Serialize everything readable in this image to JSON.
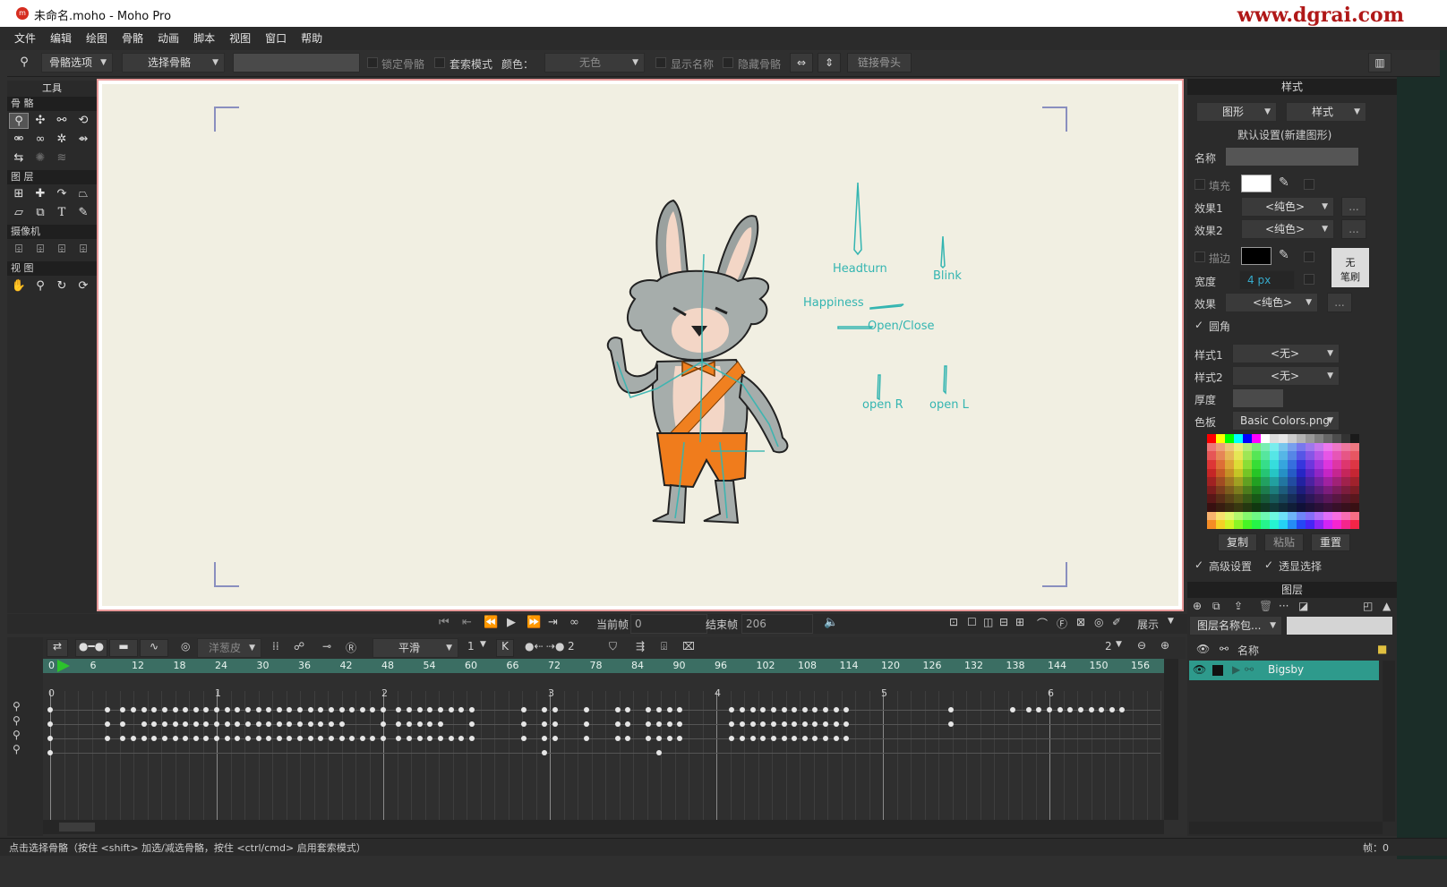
{
  "window": {
    "title": "未命名.moho - Moho Pro",
    "watermark": "www.dgrai.com"
  },
  "menu": [
    "文件",
    "编辑",
    "绘图",
    "骨骼",
    "动画",
    "脚本",
    "视图",
    "窗口",
    "帮助"
  ],
  "toolbar": {
    "bone_options": "骨骼选项",
    "select_bone": "选择骨骼",
    "lock_bone": "锁定骨骼",
    "lasso_mode": "套索模式",
    "color_label": "颜色：",
    "color_value": "无色",
    "show_names": "显示名称",
    "hide_bones": "隐藏骨骼",
    "link_bones": "链接骨头"
  },
  "tools": {
    "header": "工具",
    "sections": {
      "bone": "骨 骼",
      "layer": "图 层",
      "camera": "摄像机",
      "view": "视 图"
    }
  },
  "canvas": {
    "bone_labels": {
      "headturn": "Headturn",
      "blink": "Blink",
      "happiness": "Happiness",
      "open_close": "Open/Close",
      "open_r": "open R",
      "open_l": "open L"
    },
    "colors": {
      "background": "#f1efe2",
      "bone": "#34b5b1",
      "frame": "#e99a9a"
    }
  },
  "style_panel": {
    "title": "样式",
    "shape_dd": "图形",
    "style_dd": "样式",
    "defaults": "默认设置(新建图形)",
    "name_label": "名称",
    "fill_label": "填充",
    "effect1_label": "效果1",
    "effect1_value": "<纯色>",
    "effect2_label": "效果2",
    "effect2_value": "<纯色>",
    "stroke_label": "描边",
    "no_brush": "无\n笔刷",
    "width_label": "宽度",
    "width_value": "4 px",
    "effect_label": "效果",
    "effect_value": "<纯色>",
    "round_caps": "圆角",
    "style1_label": "样式1",
    "style1_value": "<无>",
    "style2_label": "样式2",
    "style2_value": "<无>",
    "thickness_label": "厚度",
    "palette_label": "色板",
    "palette_value": "Basic Colors.png",
    "copy": "复制",
    "paste": "粘贴",
    "reset": "重置",
    "advanced": "高级设置",
    "transparent_select": "透显选择",
    "ellipsis": "..."
  },
  "playback": {
    "current_frame_label": "当前帧",
    "current_frame": "0",
    "end_frame_label": "结束帧",
    "end_frame": "206",
    "display": "展示"
  },
  "timeline": {
    "onion_skin": "洋葱皮",
    "smooth": "平滑",
    "step": "1",
    "step2": "2",
    "zoom": "2",
    "ruler_ticks": [
      "0",
      "6",
      "12",
      "18",
      "24",
      "30",
      "36",
      "42",
      "48",
      "54",
      "60",
      "66",
      "72",
      "78",
      "84",
      "90",
      "96",
      "102",
      "108",
      "114",
      "120",
      "126",
      "132",
      "138",
      "144",
      "150",
      "156"
    ],
    "second_marks": [
      "0",
      "1",
      "2",
      "3",
      "4",
      "5",
      "6"
    ]
  },
  "layers": {
    "title": "图层",
    "filter_dd": "图层名称包...",
    "name_col": "名称",
    "layer_name": "Bigsby"
  },
  "status": {
    "hint": "点击选择骨骼（按住 <shift> 加选/减选骨骼，按住 <ctrl/cmd> 启用套索模式）",
    "frame": "帧：0"
  }
}
